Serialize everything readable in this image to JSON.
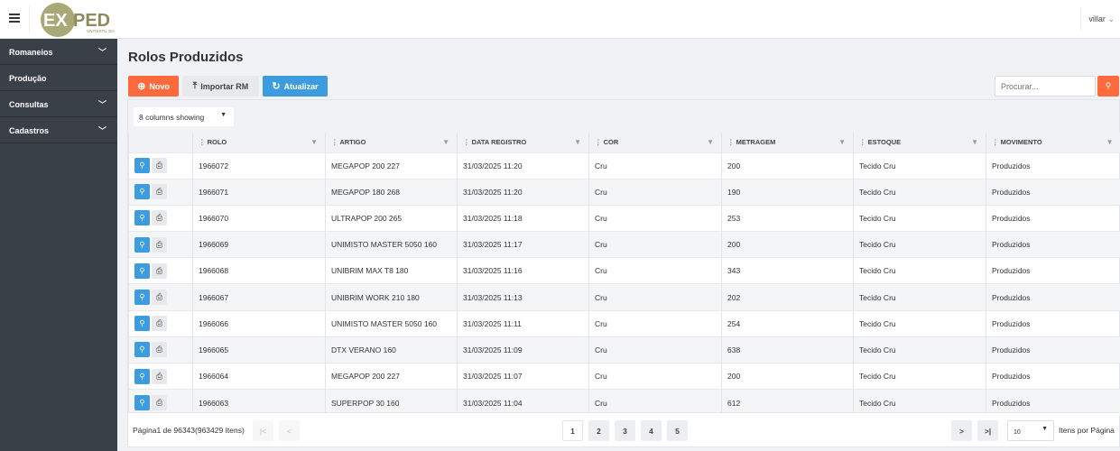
{
  "header": {
    "logo_text": "EXPED",
    "logo_sub": "UNITEXTIL S/A",
    "user": "villar"
  },
  "sidebar": {
    "items": [
      {
        "label": "Romaneios",
        "expandable": true
      },
      {
        "label": "Produção",
        "expandable": false
      },
      {
        "label": "Consultas",
        "expandable": true
      },
      {
        "label": "Cadastros",
        "expandable": true
      }
    ]
  },
  "page": {
    "title": "Rolos Produzidos"
  },
  "toolbar": {
    "novo": "Novo",
    "importar": "Importar RM",
    "atualizar": "Atualizar",
    "search_placeholder": "Procurar..."
  },
  "colors": {
    "orange": "#ff6a3d",
    "blue": "#3d9be0",
    "sidebar": "#3a4047"
  },
  "grid": {
    "columns_selector": "8 columns showing",
    "columns": [
      "ROLO",
      "ARTIGO",
      "DATA REGISTRO",
      "COR",
      "METRAGEM",
      "ESTOQUE",
      "MOVIMENTO"
    ],
    "rows": [
      [
        "1966072",
        "MEGAPOP 200 227",
        "31/03/2025 11:20",
        "Cru",
        "200",
        "Tecido Cru",
        "Produzidos"
      ],
      [
        "1966071",
        "MEGAPOP 180 268",
        "31/03/2025 11:20",
        "Cru",
        "190",
        "Tecido Cru",
        "Produzidos"
      ],
      [
        "1966070",
        "ULTRAPOP 200 265",
        "31/03/2025 11:18",
        "Cru",
        "253",
        "Tecido Cru",
        "Produzidos"
      ],
      [
        "1966069",
        "UNIMISTO MASTER 5050 160",
        "31/03/2025 11:17",
        "Cru",
        "200",
        "Tecido Cru",
        "Produzidos"
      ],
      [
        "1966068",
        "UNIBRIM MAX T8 180",
        "31/03/2025 11:16",
        "Cru",
        "343",
        "Tecido Cru",
        "Produzidos"
      ],
      [
        "1966067",
        "UNIBRIM WORK 210 180",
        "31/03/2025 11:13",
        "Cru",
        "202",
        "Tecido Cru",
        "Produzidos"
      ],
      [
        "1966066",
        "UNIMISTO MASTER 5050 160",
        "31/03/2025 11:11",
        "Cru",
        "254",
        "Tecido Cru",
        "Produzidos"
      ],
      [
        "1966065",
        "DTX VERANO 160",
        "31/03/2025 11:09",
        "Cru",
        "638",
        "Tecido Cru",
        "Produzidos"
      ],
      [
        "1966064",
        "MEGAPOP 200 227",
        "31/03/2025 11:07",
        "Cru",
        "200",
        "Tecido Cru",
        "Produzidos"
      ],
      [
        "1966063",
        "SUPERPOP 30 160",
        "31/03/2025 11:04",
        "Cru",
        "612",
        "Tecido Cru",
        "Produzidos"
      ]
    ]
  },
  "pager": {
    "info": "Página1 de 96343(963429 Itens)",
    "pages": [
      "1",
      "2",
      "3",
      "4",
      "5"
    ],
    "current": "1",
    "page_size": "10",
    "page_size_label": "Itens por Página"
  }
}
